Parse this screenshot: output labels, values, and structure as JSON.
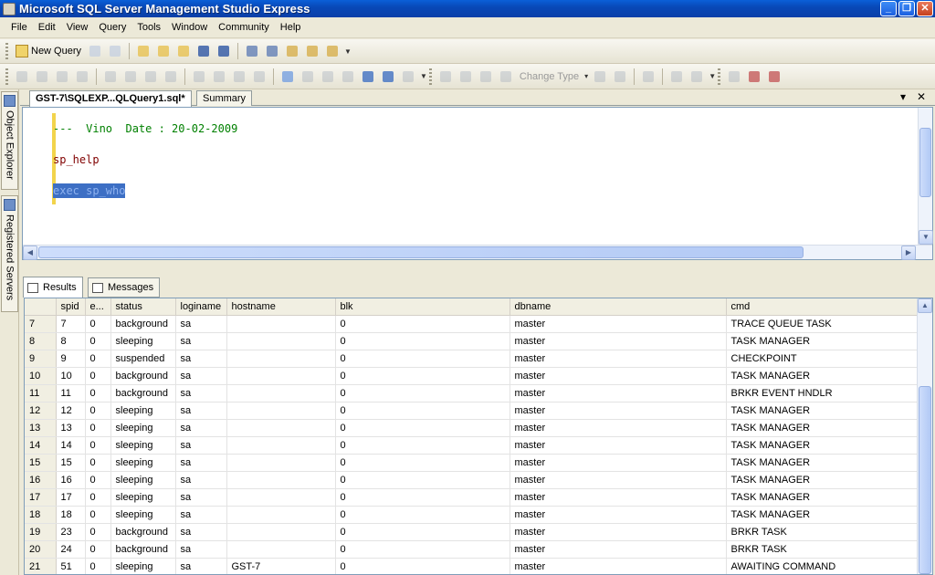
{
  "window": {
    "title": "Microsoft SQL Server Management Studio Express"
  },
  "menu": [
    "File",
    "Edit",
    "View",
    "Query",
    "Tools",
    "Window",
    "Community",
    "Help"
  ],
  "toolbar": {
    "new_query_label": "New Query",
    "change_type_label": "Change Type"
  },
  "side_tabs": {
    "object_explorer": "Object Explorer",
    "registered_servers": "Registered Servers"
  },
  "doc_tabs": {
    "query_tab": "GST-7\\SQLEXP...QLQuery1.sql*",
    "summary_tab": "Summary"
  },
  "editor": {
    "line1": "---  Vino  Date : 20-02-2009",
    "line2": "sp_help",
    "line3": "exec sp_who"
  },
  "result_tabs": {
    "results": "Results",
    "messages": "Messages"
  },
  "results": {
    "columns": [
      "spid",
      "e...",
      "status",
      "loginame",
      "hostname",
      "blk",
      "dbname",
      "cmd"
    ],
    "rows": [
      [
        "7",
        "7",
        "0",
        "background",
        "sa",
        "",
        "0",
        "master",
        "TRACE QUEUE TASK"
      ],
      [
        "8",
        "8",
        "0",
        "sleeping",
        "sa",
        "",
        "0",
        "master",
        "TASK MANAGER"
      ],
      [
        "9",
        "9",
        "0",
        "suspended",
        "sa",
        "",
        "0",
        "master",
        "CHECKPOINT"
      ],
      [
        "10",
        "10",
        "0",
        "background",
        "sa",
        "",
        "0",
        "master",
        "TASK MANAGER"
      ],
      [
        "11",
        "11",
        "0",
        "background",
        "sa",
        "",
        "0",
        "master",
        "BRKR EVENT HNDLR"
      ],
      [
        "12",
        "12",
        "0",
        "sleeping",
        "sa",
        "",
        "0",
        "master",
        "TASK MANAGER"
      ],
      [
        "13",
        "13",
        "0",
        "sleeping",
        "sa",
        "",
        "0",
        "master",
        "TASK MANAGER"
      ],
      [
        "14",
        "14",
        "0",
        "sleeping",
        "sa",
        "",
        "0",
        "master",
        "TASK MANAGER"
      ],
      [
        "15",
        "15",
        "0",
        "sleeping",
        "sa",
        "",
        "0",
        "master",
        "TASK MANAGER"
      ],
      [
        "16",
        "16",
        "0",
        "sleeping",
        "sa",
        "",
        "0",
        "master",
        "TASK MANAGER"
      ],
      [
        "17",
        "17",
        "0",
        "sleeping",
        "sa",
        "",
        "0",
        "master",
        "TASK MANAGER"
      ],
      [
        "18",
        "18",
        "0",
        "sleeping",
        "sa",
        "",
        "0",
        "master",
        "TASK MANAGER"
      ],
      [
        "19",
        "23",
        "0",
        "background",
        "sa",
        "",
        "0",
        "master",
        "BRKR TASK"
      ],
      [
        "20",
        "24",
        "0",
        "background",
        "sa",
        "",
        "0",
        "master",
        "BRKR TASK"
      ],
      [
        "21",
        "51",
        "0",
        "sleeping",
        "sa",
        "GST-7",
        "0",
        "master",
        "AWAITING COMMAND"
      ]
    ]
  }
}
